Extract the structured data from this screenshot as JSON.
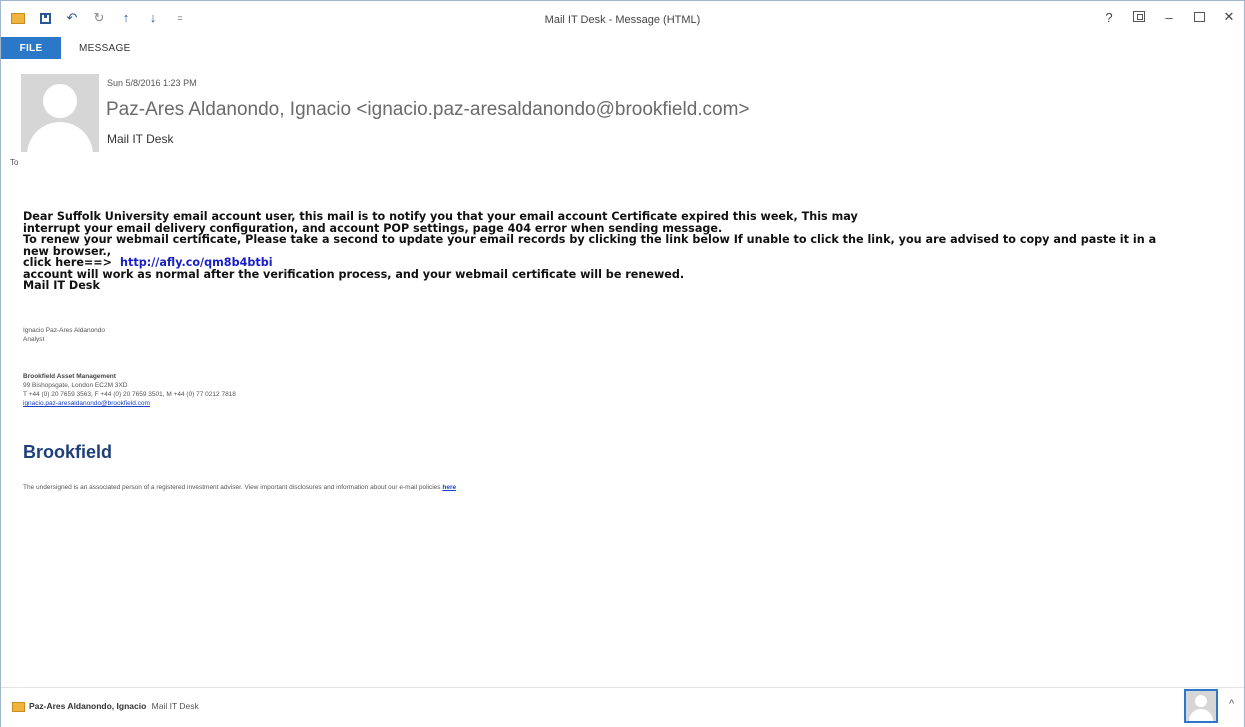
{
  "window": {
    "title": "Mail IT Desk - Message (HTML)",
    "controls": {
      "help": "?",
      "minimize": "–",
      "close": "✕"
    }
  },
  "quick_access": {
    "undo": "↶",
    "redo": "↻",
    "up": "↑",
    "down": "↓",
    "more": "="
  },
  "ribbon": {
    "file_tab": "FILE",
    "message_tab": "MESSAGE"
  },
  "header": {
    "date": "Sun 5/8/2016 1:23 PM",
    "sender": "Paz-Ares Aldanondo, Ignacio <ignacio.paz-aresaldanondo@brookfield.com>",
    "subject": "Mail IT Desk",
    "to_label": "To"
  },
  "body": {
    "line1": "Dear Suffolk University email account user, this mail is to notify you that your email account Certificate expired this week, This may",
    "line2": "interrupt your email delivery configuration, and account POP settings, page 404 error when sending message.",
    "line3": "To renew your webmail certificate,  Please take a second to update your email records by clicking the link below If unable to click the link, you are advised to copy and paste it in a",
    "line4": "new browser.,",
    "click_label": "click here==>",
    "link": "http://afly.co/qm8b4btbi",
    "line6": "account will work as normal after the verification process, and your webmail certificate will be renewed.",
    "line7": "Mail IT Desk"
  },
  "signature": {
    "name": "Ignacio Paz-Ares Aldanondo",
    "role": "Analyst",
    "company": "Brookfield Asset Management",
    "address": "99 Bishopsgate, London EC2M 3XD",
    "phones": "T +44 (0) 20 7659 3563, F +44 (0) 20 7659 3501, M +44 (0) 77 0212 7818",
    "email": "ignacio.paz-aresaldanondo@brookfield.com",
    "brand": "Brookfield",
    "disclaimer": "The undersigned is an associated person of a registered investment adviser. View important disclosures and information about our e-mail policies",
    "disclaimer_link": "here"
  },
  "people_bar": {
    "name": "Paz-Ares Aldanondo, Ignacio",
    "subject": "Mail IT Desk",
    "caret": "^"
  },
  "colors": {
    "file_tab": "#2a78c7",
    "link": "#1a20c8",
    "brand": "#1e3f78"
  }
}
